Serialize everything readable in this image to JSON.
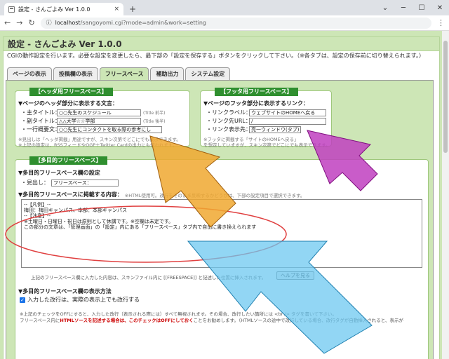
{
  "browser": {
    "tab_title": "設定 - さんごよみ Ver 1.0.0",
    "tab_close": "×",
    "new_tab": "+",
    "url_host": "localhost",
    "url_path": "/sangoyomi.cgi?mode=admin&work=setting"
  },
  "page": {
    "title_main": "設定 - ",
    "title_app": "さんごよみ Ver 1.0.0",
    "description": "CGIの動作設定を行います。必要な設定を変更したら、最下部の「設定を保存する」ボタンをクリックして下さい。（※各タブは、設定の保存前に切り替えられます。）",
    "tabs": [
      "ページの表示",
      "投稿欄の表示",
      "フリースペース",
      "補助出力",
      "システム設定"
    ]
  },
  "header_box": {
    "label": "【ヘッダ用フリースペース】",
    "heading": "▼ページのヘッダ部分に表示する文言：",
    "rows": [
      {
        "label": "・主タイトル：",
        "value": "○○先生のスケジュール",
        "hint": "(Title 前半)"
      },
      {
        "label": "・副タイトル：",
        "value": "△△大学☆☆学部",
        "hint": "(Title 後半)"
      },
      {
        "label": "・一行概要文：",
        "value": "○○先生にコンタクトを取る際の参考にし",
        "hint": ""
      }
    ],
    "note1": "※見出しは「ヘッダ掲載」用途ですが、スキン次第でどこにでも表示できます。",
    "note2": "※上記の設定は、RSSフィードやOGP＋Twitter Cardの出力にも使われます。"
  },
  "footer_box": {
    "label": "【フッタ用フリースペース】",
    "heading": "▼ページのフッタ部分に表示するリンク：",
    "link_label": "・リンクラベル：",
    "link_label_value": "ウェブサイトのHOMEへ戻る",
    "link_url": "・リンク先URL：",
    "link_url_value": "/",
    "link_target": "・リンク表示先：",
    "link_target_value": "亮一ウィンドウ(タブ)",
    "note1": "※フッタに掲載する「サイトのHOMEへ戻る」",
    "note2": "を想定していますが、スキン次第でどこにでも表示できます。"
  },
  "multi_box": {
    "label": "【多目的フリースペース】",
    "heading": "▼多目的フリースペース欄の設定",
    "caption_label": "・見出し：",
    "caption_value": "フリースペース：",
    "content_heading": "▼多目的フリースペースに掲載する内容：",
    "content_note": "※HTML使用可。改行をそのまま反映するかどうかは、下部の設定項目で選択できます。",
    "content_lines": [
      "--【凡例】--",
      "梅田：梅田キャンパス、本部：本部キャンパス",
      "--【注意】--",
      "※土曜日・日曜日・祝日は原則として休講です。※空欄は未定です。",
      "この部分の文章は、「管理画面」の「設定」内にある「フリースペース」タブ内で自由に書き換えられます"
    ],
    "insert_note": "上記のフリースペース欄に入力した内容は、スキンファイル内に [[FREESPACE]] と記述した位置に挿入されます。",
    "help_button": "ヘルプを見る",
    "display_heading": "▼多目的フリースペース欄の表示方法",
    "checkbox_label": "入力した改行は、実際の表示上でも改行する",
    "bottom_note1": "※上記のチェックをOFFにすると、入力した改行（表示される際には）すべて無視されます。その場合、改行したい箇所には <br /> タグを書いて下さい。",
    "bottom_note2_pre": "フリースペース内に",
    "bottom_note2_red": "HTMLソースを記述する場合は、このチェックはOFFにしておく",
    "bottom_note2_post": "ことをお勧めします。（HTMLソースの途中で改行している場合、改行タグが自動挿入されると、表示が"
  },
  "colors": {
    "orange_arrow": "#f0a830",
    "purple_arrow": "#c040c0",
    "blue_arrow": "#6ec8f0",
    "red_ellipse": "#e04040"
  }
}
